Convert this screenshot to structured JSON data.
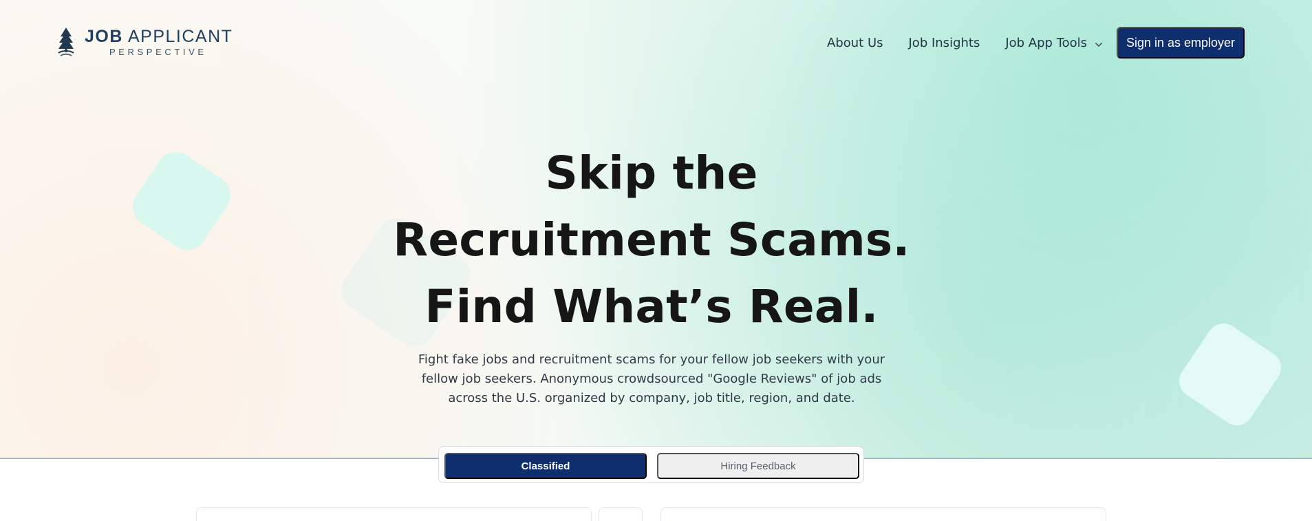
{
  "header": {
    "logo": {
      "line1_strong": "JOB",
      "line1_rest": " APPLICANT",
      "line2": "PERSPECTIVE",
      "icon": "tree-icon"
    },
    "nav": {
      "about": "About Us",
      "insights": "Job Insights",
      "tools": "Job App Tools",
      "tools_icon": "chevron-down-icon"
    },
    "signin_label": "Sign in as employer"
  },
  "hero": {
    "title": "Skip the Recruitment Scams. Find What’s Real.",
    "description": "Fight fake jobs and recruitment scams for your fellow job seekers with your fellow job seekers. Anonymous crowdsourced \"Google Reviews\" of job ads across the U.S. organized by company, job title, region, and date."
  },
  "tabs": [
    {
      "label": "Classified",
      "state": "active"
    },
    {
      "label": "Hiring Feedback",
      "state": "inactive"
    }
  ],
  "colors": {
    "primary": "#0f2e6e",
    "text": "#161616",
    "muted_text": "#303946",
    "brand_text": "#1f3f5f",
    "accent_bg": "#d8f1e9"
  }
}
